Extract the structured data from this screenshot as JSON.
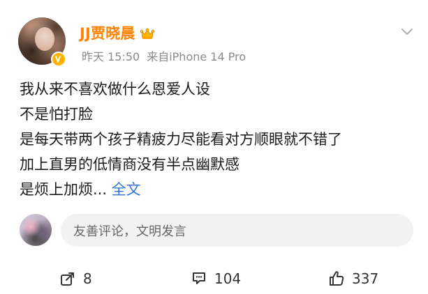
{
  "header": {
    "username": "JJ贾晓晨",
    "time": "昨天 15:50",
    "source": "来自iPhone 14 Pro",
    "icons": {
      "avatar": "user-avatar",
      "verified": "verified-badge-icon",
      "member": "crown-icon",
      "more": "chevron-down-icon"
    },
    "colors": {
      "username": "#ff8200",
      "meta": "#8a8a8a",
      "link": "#3572d4"
    }
  },
  "post": {
    "lines": [
      "我从来不喜欢做什么恩爱人设",
      "不是怕打脸",
      "是每天带两个孩子精疲力尽能看对方顺眼就不错了",
      "加上直男的低情商没有半点幽默感",
      "是烦上加烦..."
    ],
    "more_label": "全文"
  },
  "comment_bar": {
    "placeholder": "友善评论，文明发言"
  },
  "actions": {
    "share_count": "8",
    "comment_count": "104",
    "like_count": "337"
  }
}
